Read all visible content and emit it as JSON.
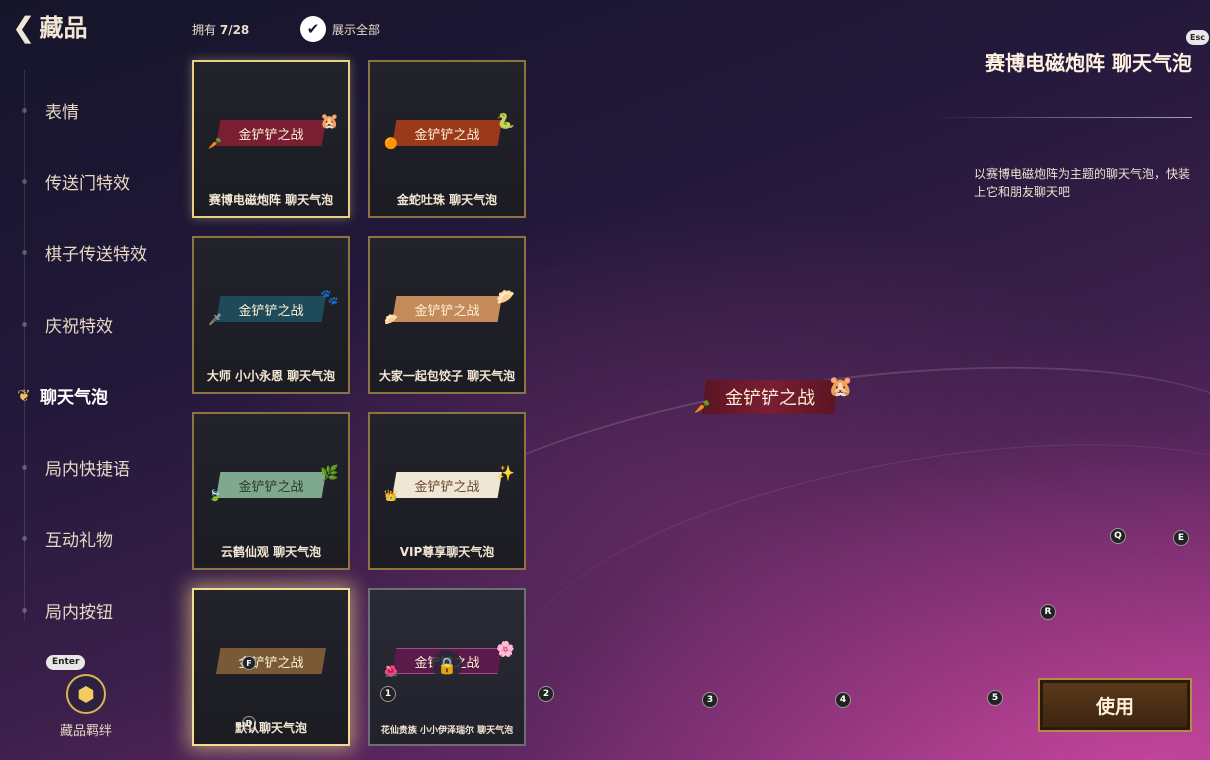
{
  "header": {
    "back_arrow": "❮",
    "title": "藏品",
    "owned_label": "拥有",
    "owned_count": "7/28",
    "show_all_label": "展示全部"
  },
  "sidebar": {
    "items": [
      {
        "label": "表情"
      },
      {
        "label": "传送门特效"
      },
      {
        "label": "棋子传送特效"
      },
      {
        "label": "庆祝特效"
      },
      {
        "label": "聊天气泡",
        "active": true
      },
      {
        "label": "局内快捷语"
      },
      {
        "label": "互动礼物"
      },
      {
        "label": "局内按钮"
      }
    ],
    "enter_key": "Enter",
    "bond_label": "藏品羁绊"
  },
  "cards": [
    {
      "banner": "金铲铲之战",
      "name": "赛博电磁炮阵 聊天气泡",
      "banner_color": "#7a1e33",
      "state": "selected"
    },
    {
      "banner": "金铲铲之战",
      "name": "金蛇吐珠 聊天气泡",
      "banner_color": "#9a3a1a",
      "state": "normal"
    },
    {
      "banner": "金铲铲之战",
      "name": "大师 小小永恩 聊天气泡",
      "banner_color": "#1f4a5a",
      "state": "normal"
    },
    {
      "banner": "金铲铲之战",
      "name": "大家一起包饺子 聊天气泡",
      "banner_color": "#c48a5a",
      "state": "normal"
    },
    {
      "banner": "金铲铲之战",
      "name": "云鹤仙观 聊天气泡",
      "banner_color": "#7fa890",
      "state": "normal"
    },
    {
      "banner": "金铲铲之战",
      "name": "VIP尊享聊天气泡",
      "banner_color": "#efe6d6",
      "banner_text_color": "#6a4a2a",
      "state": "normal"
    },
    {
      "banner": "金铲铲之战",
      "name": "默认聊天气泡",
      "banner_color": "#7a5a36",
      "state": "glow",
      "key": "F",
      "key2": "D"
    },
    {
      "banner": "金铲铲之战",
      "name": "花仙贵族 小小伊泽瑞尔 聊天气泡",
      "banner_color": "#5a1a4a",
      "state": "locked"
    }
  ],
  "hotkeys": {
    "n1": "1",
    "n2": "2",
    "n3": "3",
    "n4": "4",
    "n5": "5",
    "q": "Q",
    "e": "E",
    "r": "R",
    "esc": "Esc"
  },
  "preview": {
    "banner": "金铲铲之战"
  },
  "detail": {
    "title": "赛博电磁炮阵 聊天气泡",
    "description": "以赛博电磁炮阵为主题的聊天气泡，快装上它和朋友聊天吧"
  },
  "use_button": "使用"
}
